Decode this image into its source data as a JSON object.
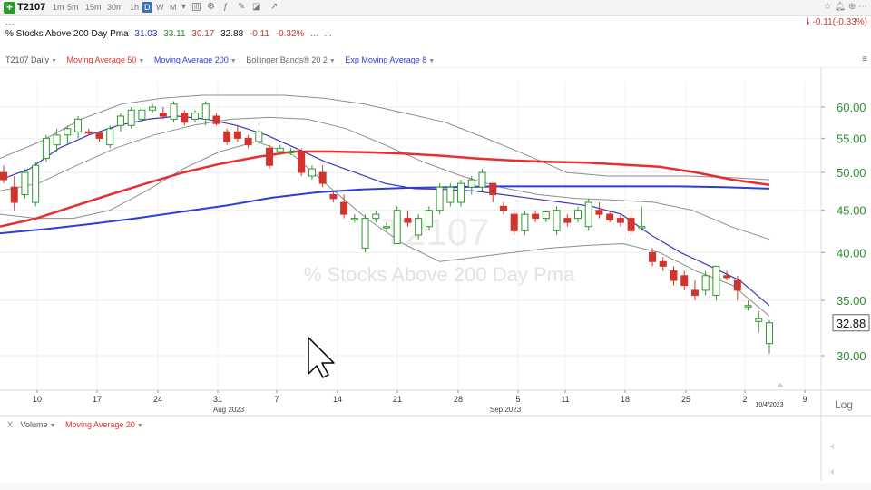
{
  "toolbar": {
    "symbol": "T2107",
    "timeframes": [
      "1m",
      "5m",
      "15m",
      "30m",
      "1h",
      "D",
      "W",
      "M"
    ],
    "active_timeframe": "D"
  },
  "header": {
    "dots": "...",
    "name": "% Stocks Above 200 Day Pma",
    "open": "31.03",
    "high": "33.11",
    "low": "30.17",
    "close": "32.88",
    "change": "-0.11",
    "change_pct": "-0.32%",
    "ellipsis": "...",
    "ellipsis2": "...",
    "change_right": "-0.11(-0.33%)"
  },
  "indicators": {
    "daily": "T2107 Daily",
    "ma50": "Moving Average 50",
    "ma200": "Moving Average 200",
    "bb": "Bollinger Bands® 20 2",
    "ema": "Exp Moving Average 8"
  },
  "volume_panel": {
    "close_x": "X",
    "volume": "Volume",
    "ma": "Moving Average 20"
  },
  "chart": {
    "watermark_symbol": "T2107",
    "watermark_name": "% Stocks Above 200 Day Pma",
    "current_price_label": "32.88",
    "log_label": "Log",
    "yaxis_ticks": [
      {
        "value": 30,
        "label": "30.00"
      },
      {
        "value": 35,
        "label": "35.00"
      },
      {
        "value": 40,
        "label": "40.00"
      },
      {
        "value": 45,
        "label": "45.00"
      },
      {
        "value": 50,
        "label": "50.00"
      },
      {
        "value": 55,
        "label": "55.00"
      },
      {
        "value": 60,
        "label": "60.00"
      }
    ],
    "xaxis_ticks": [
      "10",
      "17",
      "24",
      "31",
      "7",
      "14",
      "21",
      "28",
      "5",
      "11",
      "18",
      "25",
      "2",
      "9"
    ],
    "month_labels": [
      "Aug 2023",
      "Sep 2023"
    ],
    "date_marker": "10/4/2023"
  },
  "colors": {
    "up": "#2e9a2e",
    "down": "#d0342c",
    "ma50": "#e53030",
    "ma200": "#2b3fd6",
    "ema8": "#3a3ab8",
    "bollinger": "#8e8e8e",
    "axis_text": "#2e8b2e"
  },
  "chart_data": {
    "type": "candlestick",
    "candles": [
      [
        50.0,
        51.0,
        48.5,
        49.0
      ],
      [
        48.0,
        49.5,
        45.0,
        46.0
      ],
      [
        47.0,
        50.5,
        46.5,
        50.0
      ],
      [
        46.0,
        51.5,
        45.5,
        51.0
      ],
      [
        52.0,
        55.5,
        51.5,
        55.0
      ],
      [
        54.0,
        56.5,
        53.0,
        55.5
      ],
      [
        55.5,
        57.0,
        54.0,
        56.5
      ],
      [
        56.0,
        58.5,
        55.0,
        58.0
      ],
      [
        56.0,
        56.5,
        55.5,
        55.8
      ],
      [
        55.8,
        56.0,
        54.5,
        55.0
      ],
      [
        54.0,
        57.0,
        53.5,
        56.5
      ],
      [
        57.0,
        59.0,
        56.0,
        58.5
      ],
      [
        57.0,
        60.0,
        56.5,
        59.5
      ],
      [
        58.0,
        60.0,
        57.5,
        59.5
      ],
      [
        59.5,
        60.5,
        59.0,
        60.0
      ],
      [
        59.0,
        60.0,
        58.0,
        58.5
      ],
      [
        58.0,
        61.0,
        57.5,
        60.5
      ],
      [
        59.0,
        59.5,
        57.0,
        57.5
      ],
      [
        58.0,
        59.5,
        57.5,
        59.0
      ],
      [
        58.0,
        61.0,
        57.0,
        60.5
      ],
      [
        58.5,
        59.0,
        57.0,
        57.3
      ],
      [
        56.0,
        56.5,
        54.0,
        54.5
      ],
      [
        56.0,
        57.0,
        54.5,
        55.0
      ],
      [
        55.0,
        55.5,
        53.5,
        54.0
      ],
      [
        54.5,
        56.5,
        54.0,
        56.0
      ],
      [
        53.5,
        54.0,
        50.5,
        51.0
      ],
      [
        53.0,
        54.0,
        52.5,
        53.5
      ],
      [
        53.0,
        53.5,
        52.5,
        53.0
      ],
      [
        53.0,
        53.5,
        49.5,
        50.0
      ],
      [
        49.5,
        51.0,
        49.0,
        50.5
      ],
      [
        50.0,
        51.0,
        48.0,
        48.5
      ],
      [
        47.0,
        47.5,
        46.0,
        46.5
      ],
      [
        46.0,
        47.0,
        44.0,
        44.5
      ],
      [
        44.0,
        44.5,
        43.5,
        44.0
      ],
      [
        40.5,
        44.5,
        40.0,
        44.0
      ],
      [
        44.0,
        45.0,
        43.5,
        44.5
      ],
      [
        43.0,
        43.5,
        42.5,
        43.0
      ],
      [
        41.0,
        45.5,
        41.0,
        45.0
      ],
      [
        44.0,
        45.0,
        43.0,
        43.5
      ],
      [
        42.0,
        44.5,
        41.5,
        44.0
      ],
      [
        43.0,
        45.5,
        42.5,
        45.0
      ],
      [
        45.0,
        48.5,
        44.5,
        48.0
      ],
      [
        46.0,
        48.5,
        45.5,
        48.0
      ],
      [
        46.0,
        49.0,
        45.5,
        48.5
      ],
      [
        48.0,
        49.5,
        47.0,
        49.0
      ],
      [
        48.0,
        50.5,
        47.5,
        50.0
      ],
      [
        48.5,
        48.5,
        46.0,
        47.0
      ],
      [
        45.5,
        46.0,
        44.5,
        45.0
      ],
      [
        44.5,
        45.0,
        42.0,
        42.5
      ],
      [
        42.5,
        45.0,
        42.0,
        44.5
      ],
      [
        44.5,
        45.0,
        43.5,
        44.0
      ],
      [
        44.0,
        45.0,
        43.5,
        44.8
      ],
      [
        42.5,
        45.5,
        42.0,
        45.0
      ],
      [
        44.0,
        44.5,
        43.0,
        43.5
      ],
      [
        44.0,
        45.5,
        43.5,
        45.0
      ],
      [
        43.0,
        46.5,
        42.5,
        46.0
      ],
      [
        45.0,
        46.0,
        44.0,
        44.5
      ],
      [
        44.5,
        45.0,
        43.5,
        43.8
      ],
      [
        44.0,
        44.5,
        43.0,
        43.5
      ],
      [
        44.0,
        45.0,
        42.0,
        42.5
      ],
      [
        43.0,
        45.5,
        42.5,
        43.0
      ],
      [
        40.0,
        40.5,
        38.5,
        39.0
      ],
      [
        39.0,
        39.5,
        38.0,
        38.5
      ],
      [
        38.0,
        38.5,
        36.5,
        37.0
      ],
      [
        37.5,
        38.0,
        36.0,
        36.5
      ],
      [
        36.0,
        37.0,
        35.0,
        35.5
      ],
      [
        36.0,
        38.0,
        35.5,
        37.5
      ],
      [
        35.5,
        38.5,
        35.0,
        38.5
      ],
      [
        37.5,
        38.0,
        37.0,
        37.3
      ],
      [
        37.0,
        37.5,
        35.0,
        36.0
      ],
      [
        34.5,
        35.0,
        34.0,
        34.5
      ],
      [
        33.0,
        34.0,
        32.0,
        33.3
      ],
      [
        31.03,
        33.11,
        30.17,
        32.88
      ]
    ],
    "ma50": [
      43.0,
      44.0,
      45.5,
      47.0,
      48.5,
      50.0,
      51.2,
      52.2,
      53.0,
      53.0,
      52.9,
      52.7,
      52.4,
      52.0,
      51.7,
      51.5,
      51.4,
      51.1,
      50.8,
      50.0,
      49.0,
      48.3
    ],
    "ma200": [
      42.2,
      42.7,
      43.3,
      44.0,
      44.8,
      45.6,
      46.6,
      47.3,
      47.7,
      47.9,
      48.0,
      48.1,
      48.1,
      48.1,
      48.1,
      48.1,
      48.0,
      47.8
    ],
    "ema8": [
      49.0,
      50.5,
      53.5,
      55.5,
      57.0,
      58.0,
      58.5,
      58.0,
      57.0,
      55.5,
      53.5,
      51.5,
      50.0,
      48.5,
      47.8,
      47.7,
      47.5,
      47.0,
      46.5,
      46.0,
      45.5,
      44.5,
      42.0,
      40.0,
      38.5,
      37.0,
      34.5
    ],
    "bb_upper": [
      52.0,
      54.5,
      58.0,
      60.5,
      61.5,
      62.0,
      62.0,
      62.0,
      61.5,
      60.5,
      59.0,
      57.5,
      55.0,
      52.5,
      50.0,
      49.5,
      49.5,
      49.5,
      49.3,
      49.0
    ],
    "bb_mid": [
      47.5,
      48.5,
      51.0,
      53.5,
      55.5,
      57.0,
      58.0,
      58.3,
      58.0,
      56.5,
      54.0,
      51.5,
      49.5,
      48.0,
      47.0,
      46.5,
      46.3,
      46.0,
      45.0,
      43.0,
      41.5
    ],
    "bb_lower": [
      44.5,
      44.0,
      44.0,
      45.0,
      47.5,
      50.5,
      53.0,
      54.5,
      52.5,
      48.0,
      44.0,
      41.0,
      39.0,
      39.5,
      40.0,
      40.5,
      40.8,
      41.0,
      40.0,
      38.0,
      36.5,
      33.5
    ],
    "ylim": [
      28,
      64
    ],
    "scale": "log"
  }
}
